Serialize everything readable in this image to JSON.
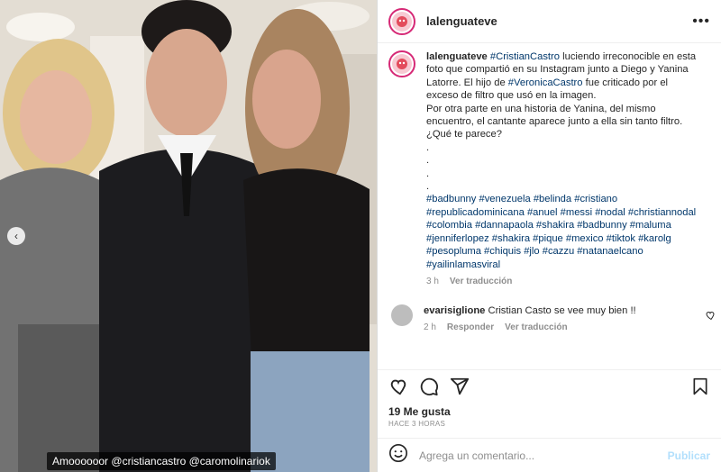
{
  "photo": {
    "caption_prefix": "Amoooooor",
    "caption_mention_1": "@cristiancastro",
    "caption_mention_2": "@caromolinariok",
    "prev_icon": "chevron-left-icon"
  },
  "header": {
    "username": "lalenguateve",
    "more_icon": "more-horizontal-icon",
    "more_label": "•••"
  },
  "post": {
    "username": "lalenguateve",
    "mention_1": "#CristianCastro",
    "text_1": " luciendo irreconocible en esta foto que compartió en su Instagram junto a Diego y Yanina Latorre. El hijo de ",
    "mention_2": "#VeronicaCastro",
    "text_2": " fue criticado por el exceso de filtro que usó en la imagen.",
    "text_3": "Por otra parte en una historia de Yanina, del mismo encuentro, el cantante aparece junto a ella sin tanto filtro. ¿Qué te parece?",
    "dots": [
      ".",
      ".",
      ".",
      "."
    ],
    "hashtags": "#badbunny #venezuela #belinda #cristiano #republicadominicana #anuel #messi #nodal #christiannodal #colombia #dannapaola #shakira #badbunny #maluma #jenniferlopez #shakira #pique #mexico #tiktok #karolg #pesopluma #chiquis #jlo #cazzu #natanaelcano #yailinlamasviral",
    "time": "3 h",
    "translation_link": "Ver traducción"
  },
  "comment": {
    "username": "evarisiglione",
    "text": " Cristian Casto se vee muy bien !!",
    "time": "2 h",
    "reply_link": "Responder",
    "translation_link": "Ver traducción"
  },
  "actions": {
    "like_icon": "heart-icon",
    "comment_icon": "comment-icon",
    "share_icon": "send-icon",
    "save_icon": "bookmark-icon"
  },
  "likes": "19 Me gusta",
  "time_ago": "HACE 3 HORAS",
  "add_comment": {
    "emoji_icon": "emoji-icon",
    "placeholder": "Agrega un comentario...",
    "post_label": "Publicar"
  },
  "colors": {
    "link": "#00376b",
    "muted": "#8e8e8e",
    "post_button": "#b2dffc",
    "avatar_ring": "#d62976"
  }
}
